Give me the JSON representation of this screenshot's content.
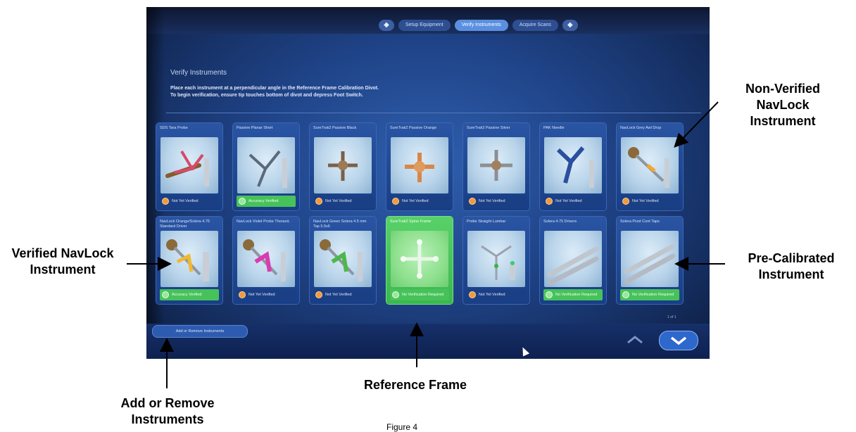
{
  "screen": {
    "nav": {
      "prev_label": "◆",
      "next_label": "◆",
      "steps": [
        "Setup Equipment",
        "Verify Instruments",
        "Acquire Scans"
      ]
    },
    "title": "Verify Instruments",
    "instructions": [
      "Place each instrument at a perpendicular angle in the Reference Frame Calibration Divot.",
      "To begin verification, ensure tip touches bottom of divot and depress Foot Switch."
    ],
    "instruments": [
      {
        "name": "SDS Tara Probe",
        "status": "Not Yet Verified"
      },
      {
        "name": "Passive Planar Short",
        "status": "Accuracy Verified"
      },
      {
        "name": "SureTrak2 Passive Black",
        "status": "Not Yet Verified"
      },
      {
        "name": "SureTrak2 Passive Orange",
        "status": "Not Yet Verified"
      },
      {
        "name": "SureTrak2 Passive Silver",
        "status": "Not Yet Verified"
      },
      {
        "name": "PAK Needle",
        "status": "Not Yet Verified"
      },
      {
        "name": "NavLock Grey Awl Drop",
        "status": "Not Yet Verified"
      },
      {
        "name": "NavLock Orange/Solera 4.75 Standard Driver",
        "status": "Accuracy Verified"
      },
      {
        "name": "NavLock Violet Probe Thoracic",
        "status": "Not Yet Verified"
      },
      {
        "name": "NavLock Green Solera 4.5 mm Tap 5.5x6",
        "status": "Not Yet Verified"
      },
      {
        "name": "SureTrak2 Spine Frame",
        "status": "No Verification Required"
      },
      {
        "name": "Probe Straight Lumbar",
        "status": "Not Yet Verified"
      },
      {
        "name": "Solera 4.75 Drivers",
        "status": "No Verification Required"
      },
      {
        "name": "Solera Pivot Cont Taps",
        "status": "No Verification Required"
      }
    ],
    "page_counter": "1 of 1",
    "add_remove_button": "Add or Remove Instruments"
  },
  "annotations": {
    "non_verified": [
      "Non-Verified",
      "NavLock",
      "Instrument"
    ],
    "verified": [
      "Verified NavLock",
      "Instrument"
    ],
    "pre_calibrated": [
      "Pre-Calibrated",
      "Instrument"
    ],
    "add_remove": [
      "Add or Remove",
      "Instruments"
    ],
    "reference_frame": "Reference Frame",
    "figure_caption": "Figure 4"
  },
  "colors": {
    "screen_bg": "#1f4387",
    "card_bg": "#2a55a3",
    "highlight_green": "#4fc762",
    "pending_orange": "#f19a3a",
    "callout_text": "#000000"
  }
}
